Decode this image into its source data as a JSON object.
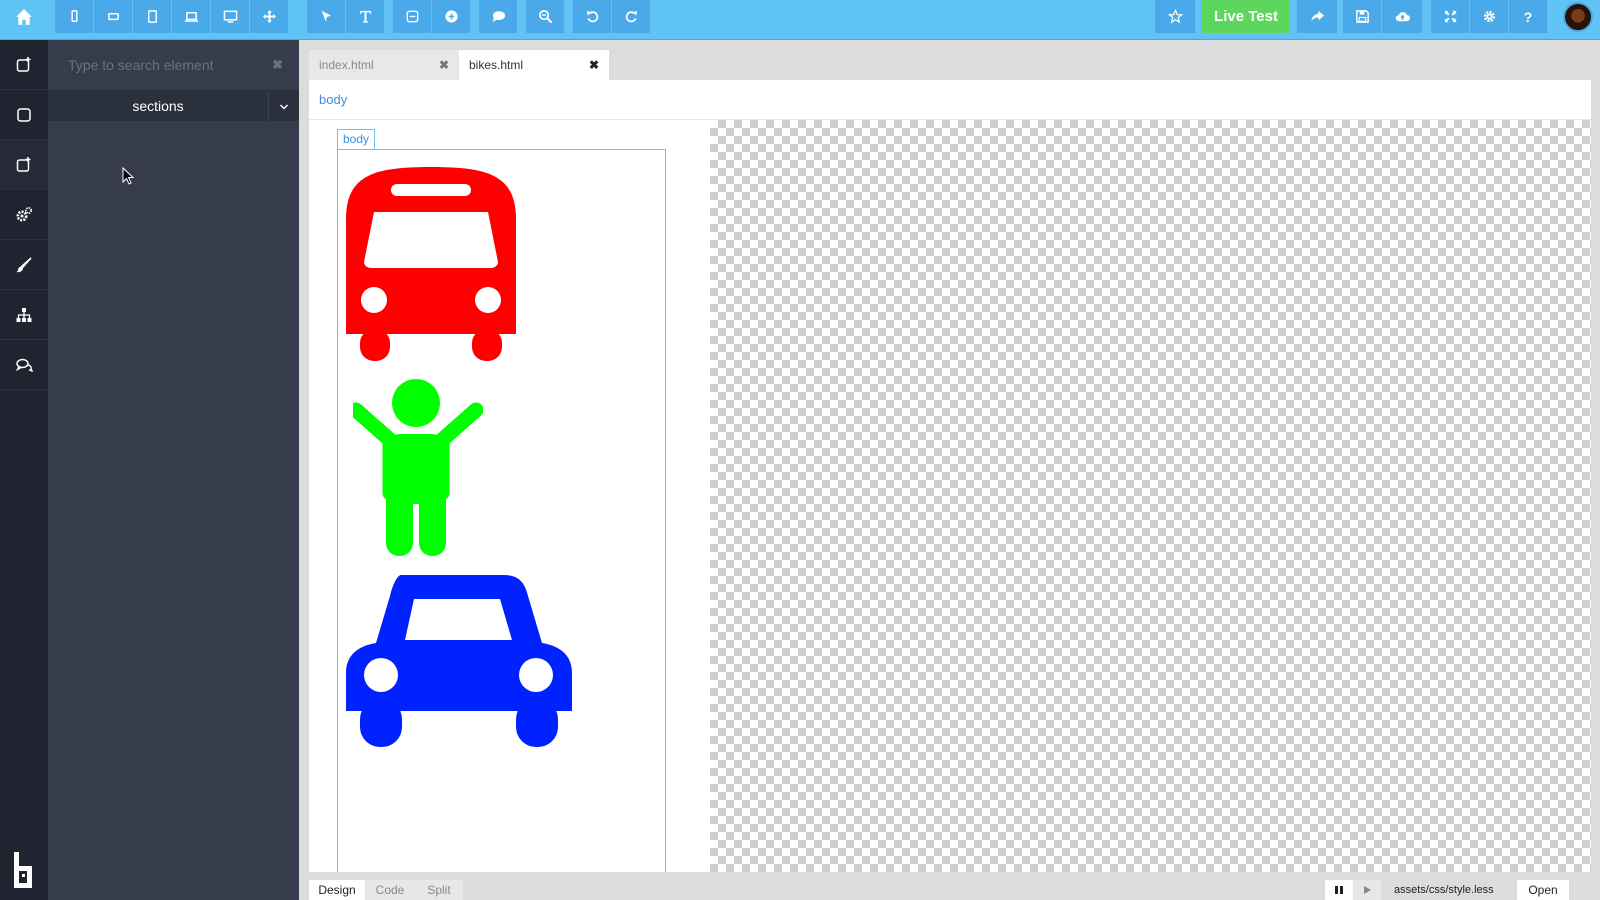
{
  "toolbar": {
    "home_icon": "home-icon",
    "device_buttons": [
      "mobile-portrait-icon",
      "mobile-landscape-icon",
      "tablet-icon",
      "laptop-icon",
      "desktop-icon",
      "fluid-icon"
    ],
    "edit_buttons": [
      "select-icon",
      "text-icon",
      "insert-icon",
      "add-icon",
      "comment-icon",
      "zoom-icon",
      "undo-icon",
      "redo-icon"
    ],
    "live_test_label": "Live Test",
    "right_icons": [
      "star-icon",
      "share-icon",
      "save-icon",
      "cloud-upload-icon",
      "fullscreen-icon",
      "settings-icon",
      "help-icon"
    ],
    "help_label": "?",
    "accent_color": "#5fc3f5",
    "live_test_color": "#5cd65c"
  },
  "rail": {
    "items": [
      "add-page-icon",
      "square-icon",
      "add-element-icon",
      "gears-icon",
      "brush-icon",
      "sitemap-icon",
      "comments-icon"
    ]
  },
  "panel": {
    "search_placeholder": "Type to search element",
    "clear_label": "✖",
    "sections_label": "sections"
  },
  "tabs": [
    {
      "label": "index.html",
      "close": "✖"
    },
    {
      "label": "bikes.html",
      "close": "✖"
    }
  ],
  "breadcrumb": "body",
  "canvas": {
    "body_tag_label": "body",
    "icons": [
      {
        "name": "bus",
        "color": "#ff0000"
      },
      {
        "name": "child",
        "color": "#00ff00"
      },
      {
        "name": "car",
        "color": "#0022ff"
      }
    ]
  },
  "bottom": {
    "modes": [
      "Design",
      "Code",
      "Split"
    ],
    "file_path": "assets/css/style.less",
    "open_label": "Open"
  }
}
